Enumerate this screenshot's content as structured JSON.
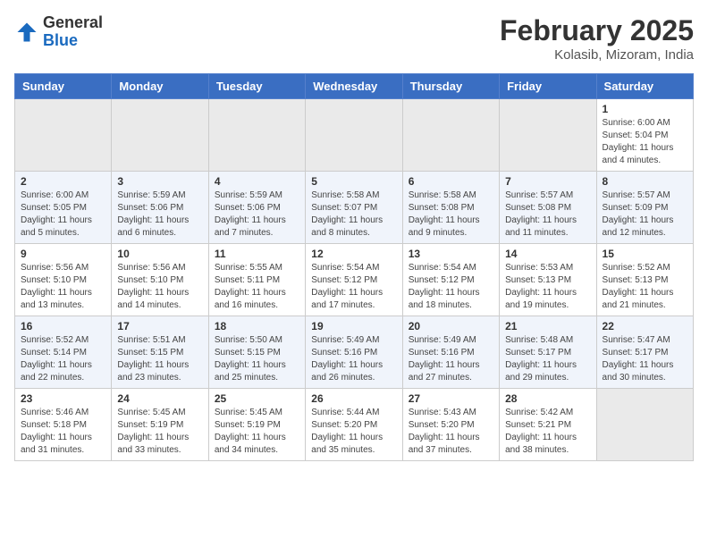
{
  "header": {
    "logo_general": "General",
    "logo_blue": "Blue",
    "month_year": "February 2025",
    "location": "Kolasib, Mizoram, India"
  },
  "weekdays": [
    "Sunday",
    "Monday",
    "Tuesday",
    "Wednesday",
    "Thursday",
    "Friday",
    "Saturday"
  ],
  "weeks": [
    [
      {
        "day": "",
        "info": ""
      },
      {
        "day": "",
        "info": ""
      },
      {
        "day": "",
        "info": ""
      },
      {
        "day": "",
        "info": ""
      },
      {
        "day": "",
        "info": ""
      },
      {
        "day": "",
        "info": ""
      },
      {
        "day": "1",
        "info": "Sunrise: 6:00 AM\nSunset: 5:04 PM\nDaylight: 11 hours and 4 minutes."
      }
    ],
    [
      {
        "day": "2",
        "info": "Sunrise: 6:00 AM\nSunset: 5:05 PM\nDaylight: 11 hours and 5 minutes."
      },
      {
        "day": "3",
        "info": "Sunrise: 5:59 AM\nSunset: 5:06 PM\nDaylight: 11 hours and 6 minutes."
      },
      {
        "day": "4",
        "info": "Sunrise: 5:59 AM\nSunset: 5:06 PM\nDaylight: 11 hours and 7 minutes."
      },
      {
        "day": "5",
        "info": "Sunrise: 5:58 AM\nSunset: 5:07 PM\nDaylight: 11 hours and 8 minutes."
      },
      {
        "day": "6",
        "info": "Sunrise: 5:58 AM\nSunset: 5:08 PM\nDaylight: 11 hours and 9 minutes."
      },
      {
        "day": "7",
        "info": "Sunrise: 5:57 AM\nSunset: 5:08 PM\nDaylight: 11 hours and 11 minutes."
      },
      {
        "day": "8",
        "info": "Sunrise: 5:57 AM\nSunset: 5:09 PM\nDaylight: 11 hours and 12 minutes."
      }
    ],
    [
      {
        "day": "9",
        "info": "Sunrise: 5:56 AM\nSunset: 5:10 PM\nDaylight: 11 hours and 13 minutes."
      },
      {
        "day": "10",
        "info": "Sunrise: 5:56 AM\nSunset: 5:10 PM\nDaylight: 11 hours and 14 minutes."
      },
      {
        "day": "11",
        "info": "Sunrise: 5:55 AM\nSunset: 5:11 PM\nDaylight: 11 hours and 16 minutes."
      },
      {
        "day": "12",
        "info": "Sunrise: 5:54 AM\nSunset: 5:12 PM\nDaylight: 11 hours and 17 minutes."
      },
      {
        "day": "13",
        "info": "Sunrise: 5:54 AM\nSunset: 5:12 PM\nDaylight: 11 hours and 18 minutes."
      },
      {
        "day": "14",
        "info": "Sunrise: 5:53 AM\nSunset: 5:13 PM\nDaylight: 11 hours and 19 minutes."
      },
      {
        "day": "15",
        "info": "Sunrise: 5:52 AM\nSunset: 5:13 PM\nDaylight: 11 hours and 21 minutes."
      }
    ],
    [
      {
        "day": "16",
        "info": "Sunrise: 5:52 AM\nSunset: 5:14 PM\nDaylight: 11 hours and 22 minutes."
      },
      {
        "day": "17",
        "info": "Sunrise: 5:51 AM\nSunset: 5:15 PM\nDaylight: 11 hours and 23 minutes."
      },
      {
        "day": "18",
        "info": "Sunrise: 5:50 AM\nSunset: 5:15 PM\nDaylight: 11 hours and 25 minutes."
      },
      {
        "day": "19",
        "info": "Sunrise: 5:49 AM\nSunset: 5:16 PM\nDaylight: 11 hours and 26 minutes."
      },
      {
        "day": "20",
        "info": "Sunrise: 5:49 AM\nSunset: 5:16 PM\nDaylight: 11 hours and 27 minutes."
      },
      {
        "day": "21",
        "info": "Sunrise: 5:48 AM\nSunset: 5:17 PM\nDaylight: 11 hours and 29 minutes."
      },
      {
        "day": "22",
        "info": "Sunrise: 5:47 AM\nSunset: 5:17 PM\nDaylight: 11 hours and 30 minutes."
      }
    ],
    [
      {
        "day": "23",
        "info": "Sunrise: 5:46 AM\nSunset: 5:18 PM\nDaylight: 11 hours and 31 minutes."
      },
      {
        "day": "24",
        "info": "Sunrise: 5:45 AM\nSunset: 5:19 PM\nDaylight: 11 hours and 33 minutes."
      },
      {
        "day": "25",
        "info": "Sunrise: 5:45 AM\nSunset: 5:19 PM\nDaylight: 11 hours and 34 minutes."
      },
      {
        "day": "26",
        "info": "Sunrise: 5:44 AM\nSunset: 5:20 PM\nDaylight: 11 hours and 35 minutes."
      },
      {
        "day": "27",
        "info": "Sunrise: 5:43 AM\nSunset: 5:20 PM\nDaylight: 11 hours and 37 minutes."
      },
      {
        "day": "28",
        "info": "Sunrise: 5:42 AM\nSunset: 5:21 PM\nDaylight: 11 hours and 38 minutes."
      },
      {
        "day": "",
        "info": ""
      }
    ]
  ]
}
